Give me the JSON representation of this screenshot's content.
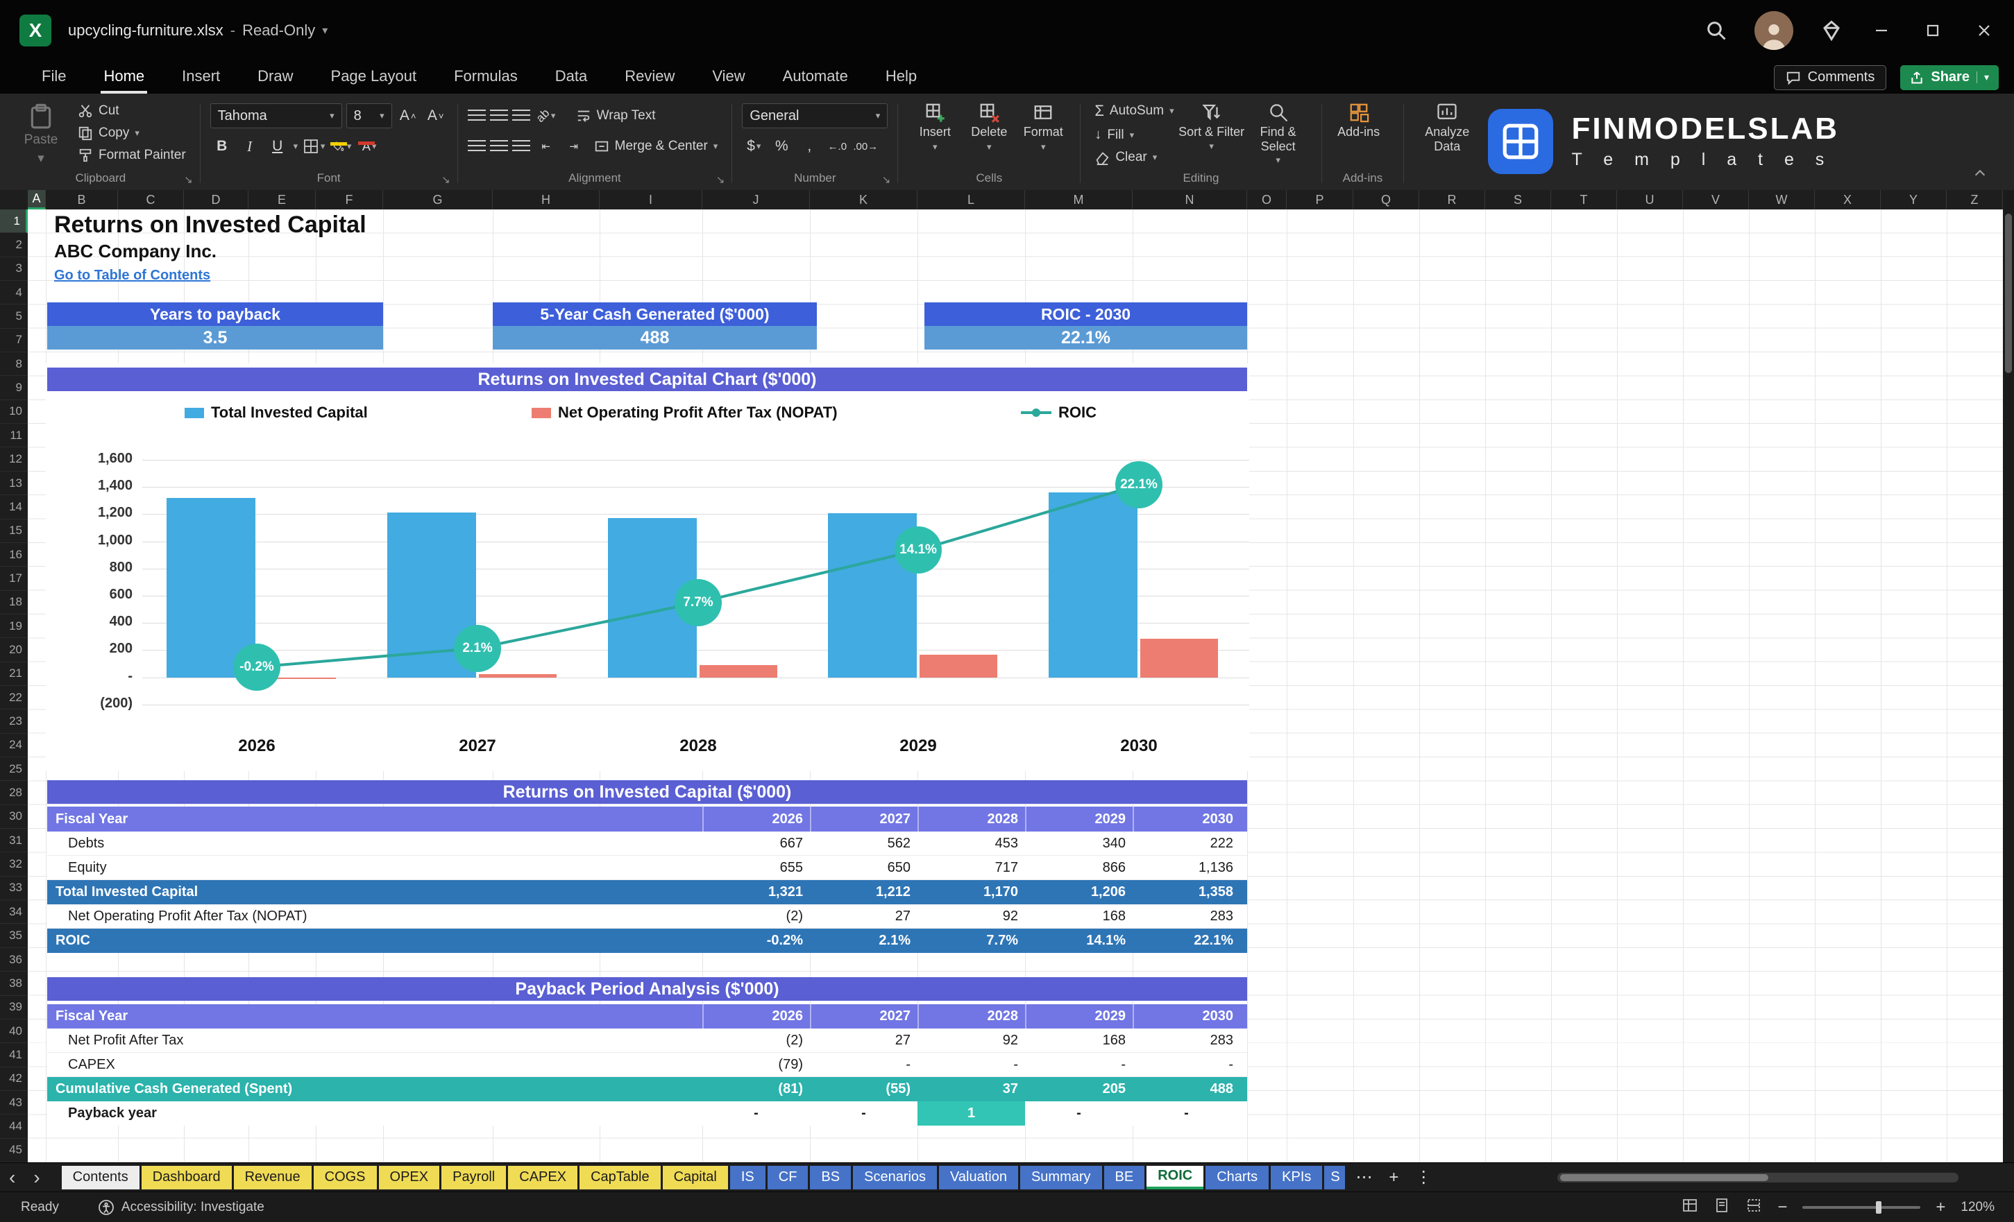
{
  "window": {
    "filename": "upcycling-furniture.xlsx",
    "separator": "-",
    "mode": "Read-Only"
  },
  "menu": {
    "items": [
      "File",
      "Home",
      "Insert",
      "Draw",
      "Page Layout",
      "Formulas",
      "Data",
      "Review",
      "View",
      "Automate",
      "Help"
    ],
    "active": "Home",
    "comments": "Comments",
    "share": "Share"
  },
  "ribbon": {
    "clipboard": {
      "paste": "Paste",
      "cut": "Cut",
      "copy": "Copy",
      "format_painter": "Format Painter",
      "group": "Clipboard"
    },
    "font": {
      "name": "Tahoma",
      "size": "8",
      "bold": "B",
      "italic": "I",
      "underline": "U",
      "group": "Font"
    },
    "alignment": {
      "wrap": "Wrap Text",
      "merge": "Merge & Center",
      "group": "Alignment"
    },
    "number": {
      "format": "General",
      "group": "Number"
    },
    "cells": {
      "insert": "Insert",
      "delete": "Delete",
      "format": "Format",
      "group": "Cells"
    },
    "editing": {
      "autosum": "AutoSum",
      "fill": "Fill",
      "clear": "Clear",
      "sort": "Sort & Filter",
      "find": "Find & Select",
      "group": "Editing"
    },
    "addins": {
      "label": "Add-ins",
      "group": "Add-ins"
    },
    "analyze": {
      "label": "Analyze Data"
    },
    "brand": {
      "name": "FINMODELSLAB",
      "sub": "T e m p l a t e s"
    }
  },
  "grid": {
    "columns": [
      "A",
      "B",
      "C",
      "D",
      "E",
      "F",
      "G",
      "H",
      "I",
      "J",
      "K",
      "L",
      "M",
      "N",
      "O",
      "P",
      "Q",
      "R",
      "S",
      "T",
      "U",
      "V",
      "W",
      "X",
      "Y",
      "Z"
    ],
    "rows": [
      "1",
      "2",
      "3",
      "4",
      "5",
      "7",
      "8",
      "9",
      "10",
      "11",
      "12",
      "13",
      "14",
      "15",
      "16",
      "17",
      "18",
      "19",
      "20",
      "21",
      "22",
      "23",
      "24",
      "25",
      "28",
      "30",
      "31",
      "32",
      "33",
      "34",
      "35",
      "36",
      "38",
      "39",
      "40",
      "41",
      "42",
      "43",
      "44",
      "45"
    ]
  },
  "content": {
    "title": "Returns on Invested Capital",
    "company": "ABC Company Inc.",
    "link": "Go to Table of Contents",
    "kpis": [
      {
        "label": "Years to payback",
        "value": "3.5"
      },
      {
        "label": "5-Year Cash Generated ($'000)",
        "value": "488"
      },
      {
        "label": "ROIC - 2030",
        "value": "22.1%"
      }
    ],
    "table1": {
      "title": "Returns on Invested Capital ($'000)",
      "header_label": "Fiscal Year",
      "years": [
        "2026",
        "2027",
        "2028",
        "2029",
        "2030"
      ],
      "rows": [
        {
          "label": "Debts",
          "style": "plain",
          "values": [
            "667",
            "562",
            "453",
            "340",
            "222"
          ]
        },
        {
          "label": "Equity",
          "style": "plain",
          "values": [
            "655",
            "650",
            "717",
            "866",
            "1,136"
          ]
        },
        {
          "label": "Total Invested Capital",
          "style": "blue",
          "values": [
            "1,321",
            "1,212",
            "1,170",
            "1,206",
            "1,358"
          ]
        },
        {
          "label": "Net Operating Profit After Tax (NOPAT)",
          "style": "plain",
          "values": [
            "(2)",
            "27",
            "92",
            "168",
            "283"
          ]
        },
        {
          "label": "ROIC",
          "style": "blue",
          "values": [
            "-0.2%",
            "2.1%",
            "7.7%",
            "14.1%",
            "22.1%"
          ]
        }
      ]
    },
    "table2": {
      "title": "Payback Period Analysis ($'000)",
      "header_label": "Fiscal Year",
      "years": [
        "2026",
        "2027",
        "2028",
        "2029",
        "2030"
      ],
      "rows": [
        {
          "label": "Net Profit After Tax",
          "style": "plain",
          "values": [
            "(2)",
            "27",
            "92",
            "168",
            "283"
          ]
        },
        {
          "label": "CAPEX",
          "style": "plain",
          "values": [
            "(79)",
            "-",
            "-",
            "-",
            "-"
          ]
        },
        {
          "label": "Cumulative Cash Generated (Spent)",
          "style": "teal",
          "values": [
            "(81)",
            "(55)",
            "37",
            "205",
            "488"
          ]
        },
        {
          "label": "Payback year",
          "style": "payback",
          "values": [
            "-",
            "-",
            "1",
            "-",
            "-"
          ],
          "highlight_index": 2
        }
      ]
    }
  },
  "chart_data": {
    "type": "combo",
    "title": "Returns on Invested Capital Chart ($'000)",
    "categories": [
      "2026",
      "2027",
      "2028",
      "2029",
      "2030"
    ],
    "series": [
      {
        "name": "Total Invested Capital",
        "type": "bar",
        "color": "#42abe1",
        "values": [
          1321,
          1212,
          1170,
          1206,
          1358
        ]
      },
      {
        "name": "Net Operating Profit After Tax (NOPAT)",
        "type": "bar",
        "color": "#ed7d70",
        "values": [
          -2,
          27,
          92,
          168,
          283
        ]
      },
      {
        "name": "ROIC",
        "type": "line",
        "color": "#2ba79b",
        "values_pct": [
          -0.2,
          2.1,
          7.7,
          14.1,
          22.1
        ],
        "point_labels": [
          "-0.2%",
          "2.1%",
          "7.7%",
          "14.1%",
          "22.1%"
        ]
      }
    ],
    "y_axis": {
      "min": -200,
      "max": 1600,
      "step": 200,
      "tick_labels": [
        "1,600",
        "1,400",
        "1,200",
        "1,000",
        "800",
        "600",
        "400",
        "200",
        "-",
        "(200)"
      ]
    },
    "legend_position": "top",
    "gridlines": true
  },
  "tabs": {
    "items": [
      {
        "label": "Contents",
        "style": "light"
      },
      {
        "label": "Dashboard",
        "style": "yellow"
      },
      {
        "label": "Revenue",
        "style": "yellow"
      },
      {
        "label": "COGS",
        "style": "yellow"
      },
      {
        "label": "OPEX",
        "style": "yellow"
      },
      {
        "label": "Payroll",
        "style": "yellow"
      },
      {
        "label": "CAPEX",
        "style": "yellow"
      },
      {
        "label": "CapTable",
        "style": "yellow"
      },
      {
        "label": "Capital",
        "style": "yellow"
      },
      {
        "label": "IS",
        "style": "blue"
      },
      {
        "label": "CF",
        "style": "blue"
      },
      {
        "label": "BS",
        "style": "blue"
      },
      {
        "label": "Scenarios",
        "style": "blue"
      },
      {
        "label": "Valuation",
        "style": "blue"
      },
      {
        "label": "Summary",
        "style": "blue"
      },
      {
        "label": "BE",
        "style": "blue"
      },
      {
        "label": "ROIC",
        "style": "active"
      },
      {
        "label": "Charts",
        "style": "blue"
      },
      {
        "label": "KPIs",
        "style": "blue"
      },
      {
        "label": "S",
        "style": "blue-clipped"
      }
    ]
  },
  "statusbar": {
    "ready": "Ready",
    "accessibility": "Accessibility: Investigate",
    "zoom": "120%"
  }
}
